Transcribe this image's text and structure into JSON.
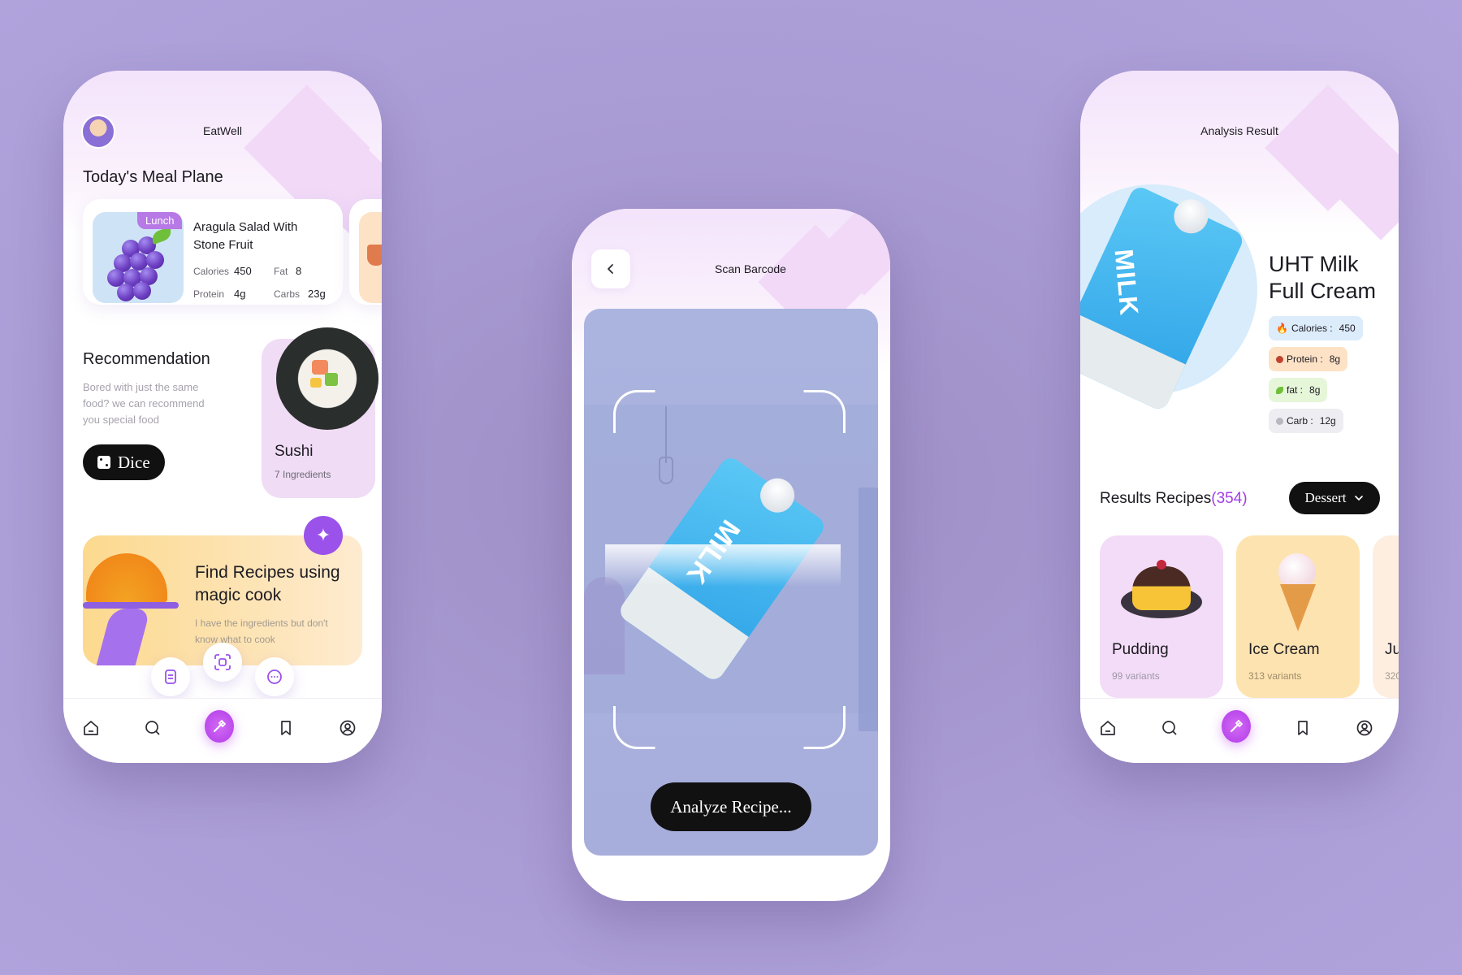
{
  "colors": {
    "background": "#a99bd4",
    "accent": "#b13ce8",
    "lunch_badge": "#b779e6",
    "dark_button": "#111111"
  },
  "home": {
    "app_title": "EatWell",
    "meal_section_title": "Today's Meal Plane",
    "meal_card": {
      "badge": "Lunch",
      "name_line1": "Aragula Salad With",
      "name_line2": "Stone Fruit",
      "calories_label": "Calories",
      "calories_value": "450",
      "fat_label": "Fat",
      "fat_value": "8",
      "protein_label": "Protein",
      "protein_value": "4g",
      "carbs_label": "Carbs",
      "carbs_value": "23g"
    },
    "recommendation": {
      "title": "Recommendation",
      "desc_line1": "Bored with just the same",
      "desc_line2": "food? we can recommend",
      "desc_line3": "you special food",
      "dice_label": "Dice",
      "sushi_name": "Sushi",
      "sushi_sub": "7 Ingredients"
    },
    "magic": {
      "title_line1": "Find Recipes using",
      "title_line2": "magic cook",
      "desc_line1": "I have the ingredients but don't",
      "desc_line2": "know what to cook"
    },
    "nav": [
      "home-icon",
      "search-icon",
      "wand-icon",
      "bookmark-icon",
      "profile-icon"
    ]
  },
  "scan": {
    "title": "Scan Barcode",
    "carton_label": "MILK",
    "analyze_label": "Analyze Recipe..."
  },
  "analysis": {
    "title": "Analysis Result",
    "product_line1": "UHT Milk",
    "product_line2": "Full Cream",
    "carton_label": "MILK",
    "chips": [
      {
        "label": "Calories :",
        "value": "450",
        "icon": "fire-icon",
        "color": "#dcecfb"
      },
      {
        "label": "Protein :",
        "value": "8g",
        "icon": "meat-icon",
        "color": "#fde2c6"
      },
      {
        "label": "fat :",
        "value": "8g",
        "icon": "leaf-icon",
        "color": "#e6f6d9"
      },
      {
        "label": "Carb :",
        "value": "12g",
        "icon": "grain-icon",
        "color": "#eeeef2"
      }
    ],
    "results_label": "Results Recipes",
    "results_count": "(354)",
    "filter_label": "Dessert",
    "recipes": [
      {
        "name": "Pudding",
        "sub": "99 variants",
        "color": "#f3dcf7"
      },
      {
        "name": "Ice Cream",
        "sub": "313 variants",
        "color": "#fde3b0"
      },
      {
        "name": "Ju",
        "sub": "320",
        "color": "#feeee0"
      }
    ]
  }
}
